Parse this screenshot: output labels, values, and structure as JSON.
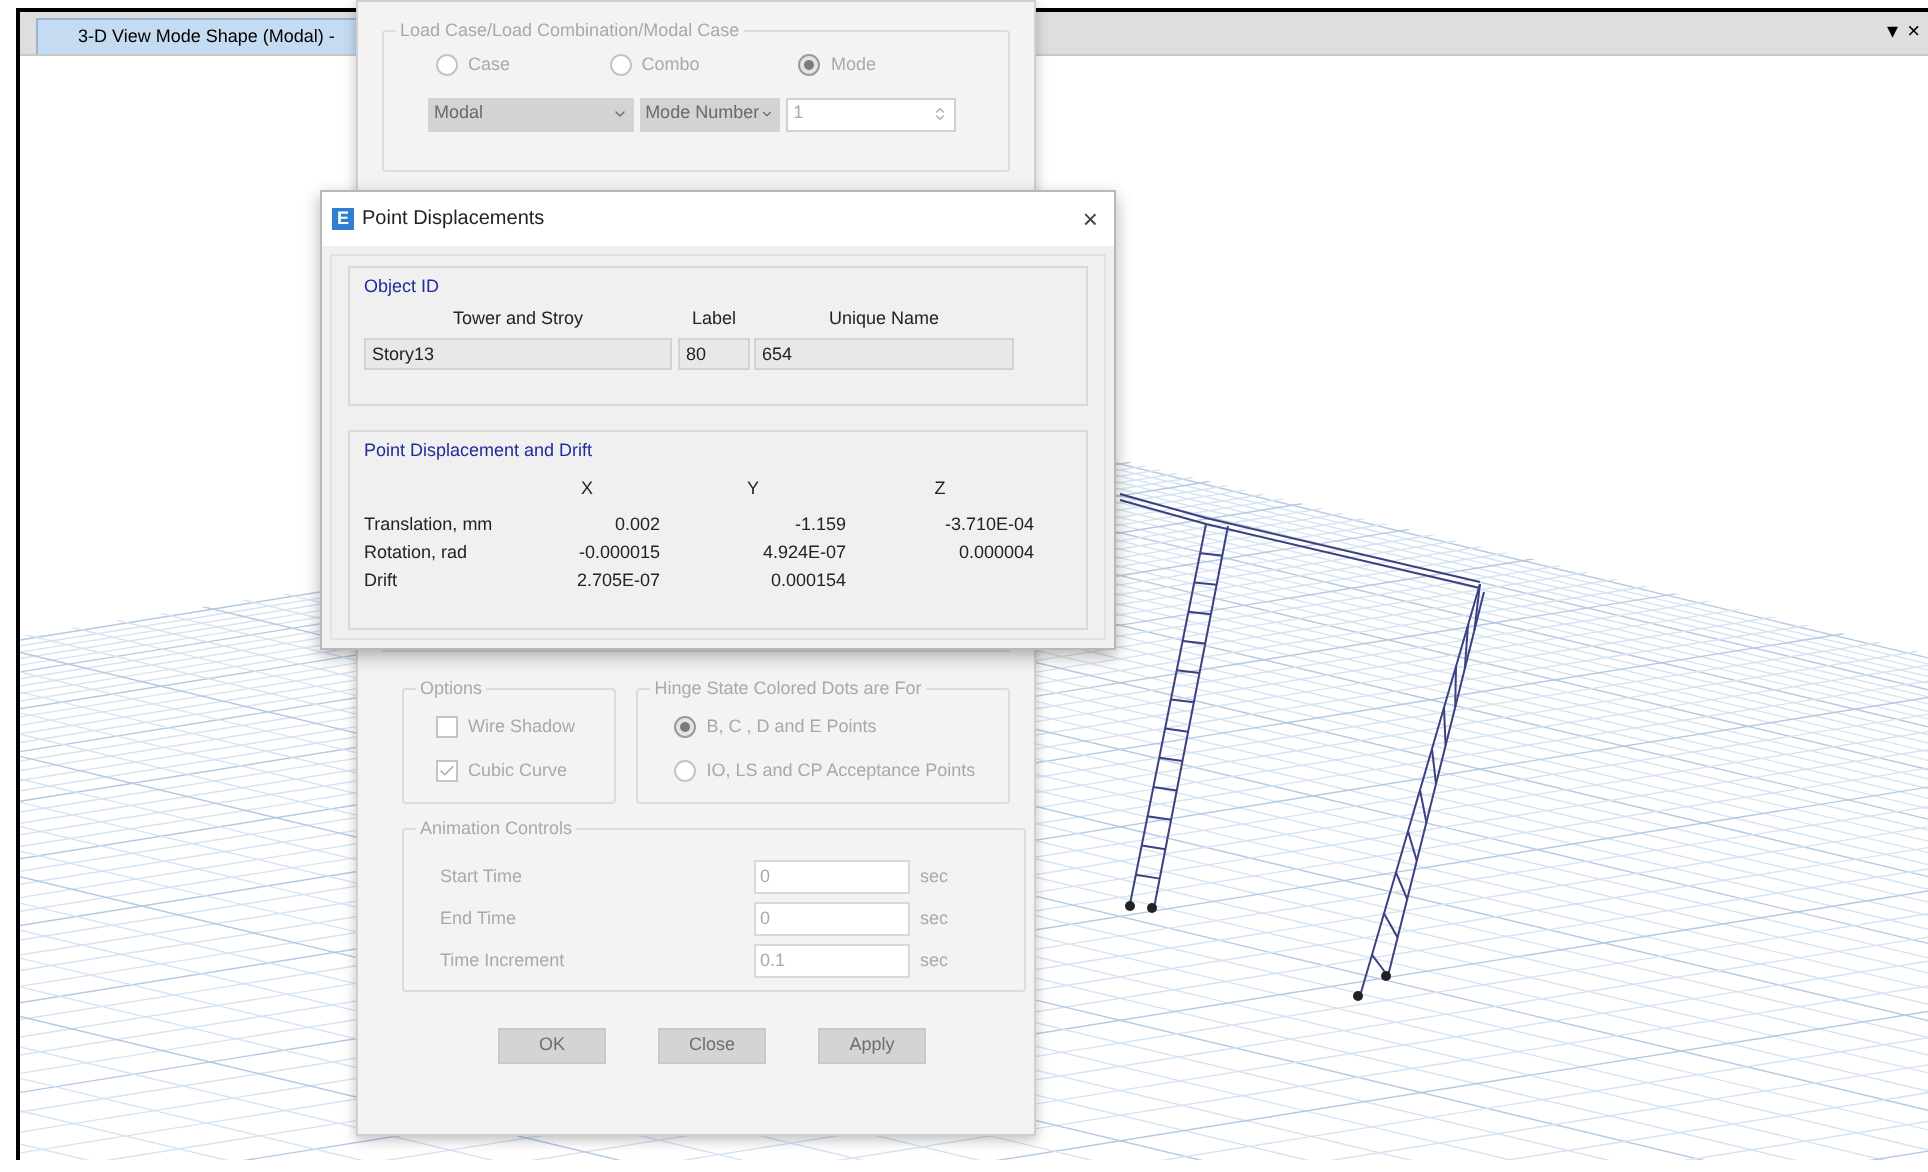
{
  "tab": {
    "title": "3-D View  Mode Shape (Modal) -",
    "selected": true
  },
  "pane_controls": [
    "▾",
    "×"
  ],
  "mode_shape_dialog": {
    "load_case_group": {
      "title": "Load Case/Load Combination/Modal Case",
      "options": [
        {
          "label": "Case",
          "selected": false
        },
        {
          "label": "Combo",
          "selected": false
        },
        {
          "label": "Mode",
          "selected": true
        }
      ],
      "case_name": "Modal",
      "mode_selector": "Mode Number",
      "mode_number": "1"
    },
    "options_group": {
      "title": "Options",
      "items": [
        {
          "label": "Wire Shadow",
          "checked": false
        },
        {
          "label": "Cubic Curve",
          "checked": true
        }
      ]
    },
    "hinge_group": {
      "title": "Hinge State Colored Dots are For",
      "options": [
        {
          "label": "B, C , D and E Points",
          "selected": true
        },
        {
          "label": "IO, LS and CP Acceptance Points",
          "selected": false
        }
      ]
    },
    "animation_group": {
      "title": "Animation Controls",
      "rows": [
        {
          "label": "Start Time",
          "value": "0",
          "unit": "sec"
        },
        {
          "label": "End Time",
          "value": "0",
          "unit": "sec"
        },
        {
          "label": "Time Increment",
          "value": "0.1",
          "unit": "sec"
        }
      ]
    },
    "buttons": [
      "OK",
      "Close",
      "Apply"
    ]
  },
  "point_dialog": {
    "title": "Point Displacements",
    "app_icon": "E",
    "close": "×",
    "object_id": {
      "title": "Object ID",
      "columns": [
        "Tower and Stroy",
        "Label",
        "Unique Name"
      ],
      "values": [
        "Story13",
        "80",
        "654"
      ]
    },
    "displacement": {
      "title": "Point Displacement and Drift",
      "columns": [
        "X",
        "Y",
        "Z"
      ],
      "rows": [
        {
          "label": "Translation, mm",
          "values": [
            "0.002",
            "-1.159",
            "-3.710E-04"
          ]
        },
        {
          "label": "Rotation, rad",
          "values": [
            "-0.000015",
            "4.924E-07",
            "0.000004"
          ]
        },
        {
          "label": "Drift",
          "values": [
            "2.705E-07",
            "0.000154"
          ]
        }
      ]
    }
  }
}
